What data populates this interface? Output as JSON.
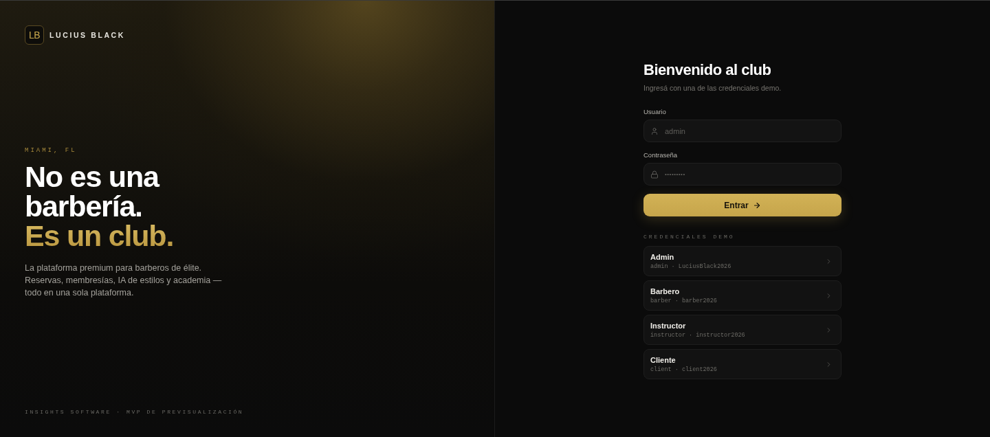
{
  "brand": {
    "monogram": "LB",
    "name": "LUCIUS BLACK"
  },
  "hero": {
    "location": "MIAMI, FL",
    "headline": [
      "No es una",
      "barbería."
    ],
    "highlight": "Es un club.",
    "description": "La plataforma premium para barberos de élite. Reservas, membresías, IA de estilos y academia — todo en una sola plataforma."
  },
  "footer": "INSIGHTS SOFTWARE · MVP DE PREVISUALIZACIÓN",
  "login": {
    "title": "Bienvenido al club",
    "subtitle": "Ingresá con una de las credenciales demo.",
    "fields": [
      {
        "kind": "user",
        "label": "Usuario",
        "placeholder": "admin"
      },
      {
        "kind": "password",
        "label": "Contraseña",
        "placeholder": "•••••••••"
      }
    ],
    "submit": "Entrar"
  },
  "demo": {
    "heading": "CREDENCIALES DEMO",
    "accounts": [
      {
        "role": "Admin",
        "credentials": "admin · LuciusBlack2026"
      },
      {
        "role": "Barbero",
        "credentials": "barber · barber2026"
      },
      {
        "role": "Instructor",
        "credentials": "instructor · instructor2026"
      },
      {
        "role": "Cliente",
        "credentials": "client · client2026"
      }
    ]
  }
}
